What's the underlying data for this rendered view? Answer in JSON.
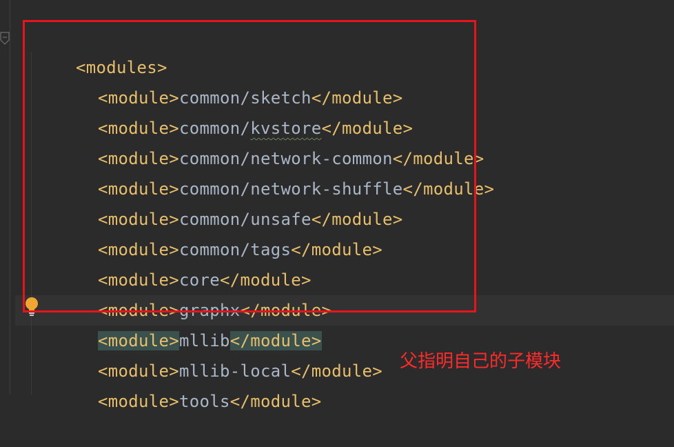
{
  "editor": {
    "lines": [
      {
        "open": "<modules>"
      },
      {
        "open": "<module>",
        "text": "common/sketch",
        "close": "</module>"
      },
      {
        "open": "<module>",
        "text_pre": "common/",
        "text_squiggle": "kvstore",
        "close": "</module>"
      },
      {
        "open": "<module>",
        "text": "common/network-common",
        "close": "</module>"
      },
      {
        "open": "<module>",
        "text": "common/network-shuffle",
        "close": "</module>"
      },
      {
        "open": "<module>",
        "text": "common/unsafe",
        "close": "</module>"
      },
      {
        "open": "<module>",
        "text": "common/tags",
        "close": "</module>"
      },
      {
        "open": "<module>",
        "text": "core",
        "close": "</module>"
      },
      {
        "open": "<module>",
        "text": "graphx",
        "close": "</module>"
      },
      {
        "open": "<module>",
        "text": "mllib",
        "close": "</module>"
      },
      {
        "open": "<module>",
        "text": "mllib-local",
        "close": "</module>"
      },
      {
        "open": "<module>",
        "text": "tools",
        "close": "</module>"
      }
    ]
  },
  "annotation": {
    "text": "父指明自己的子模块",
    "color": "#ff2a2a"
  },
  "icons": {
    "bulb": "lightbulb-icon",
    "fold": "fold-marker-icon"
  },
  "colors": {
    "tag": "#e8bf6a",
    "text": "#a9b7c6",
    "background": "#2b2b2b",
    "highlight_box": "#e8141c"
  }
}
